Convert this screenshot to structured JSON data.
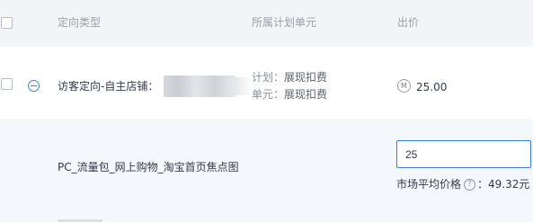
{
  "header": {
    "col_targeting_type": "定向类型",
    "col_plan_unit": "所属计划单元",
    "col_bid": "出价"
  },
  "row1": {
    "targeting_name": "访客定向-自主店铺：",
    "plan_label": "计划：",
    "plan_value": "展现扣费",
    "unit_label": "单元：",
    "unit_value": "展现扣费",
    "coin_symbol": "M",
    "bid": "25.00"
  },
  "row2": {
    "placement_name": "PC_流量包_网上购物_淘宝首页焦点图",
    "bid_input_value": "25",
    "market_avg_label": "市场平均价格",
    "help_symbol": "?",
    "market_avg_value": "：49.32元"
  },
  "colors": {
    "accent": "#3c7ee6",
    "header_bg": "#f2f4f7",
    "expanded_row_bg": "#f4f8fd"
  }
}
